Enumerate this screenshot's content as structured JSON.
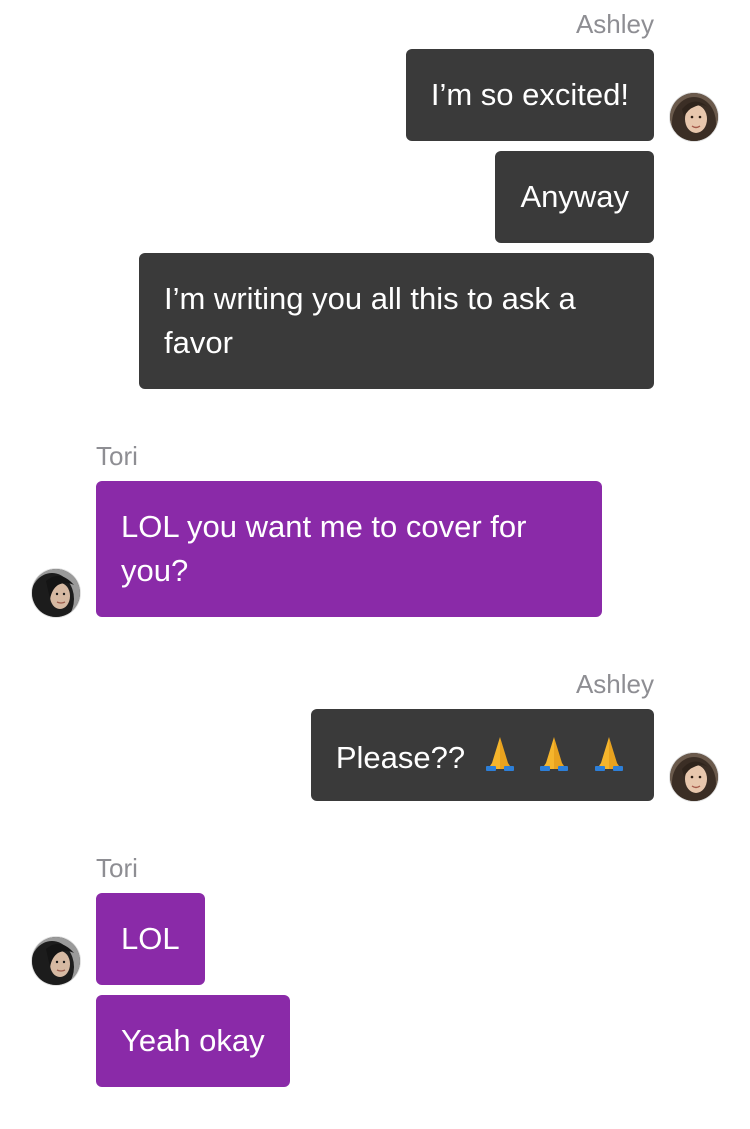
{
  "colors": {
    "outgoing_bubble": "#3a3a3a",
    "incoming_bubble": "#8a2aa8",
    "sender_name": "#8e8e93"
  },
  "icons": {
    "avatar_ashley": "avatar-photo",
    "avatar_tori": "avatar-photo",
    "emoji": "folded-hands-icon"
  },
  "messages": {
    "group1": {
      "sender": "Ashley",
      "m1": "I’m so excited!",
      "m2": "Anyway",
      "m3": "I’m writing you all this to ask a favor"
    },
    "group2": {
      "sender": "Tori",
      "m1": "LOL you want me to cover for you?"
    },
    "group3": {
      "sender": "Ashley",
      "m1": "Please??"
    },
    "group4": {
      "sender": "Tori",
      "m1": "LOL",
      "m2": "Yeah okay"
    }
  }
}
